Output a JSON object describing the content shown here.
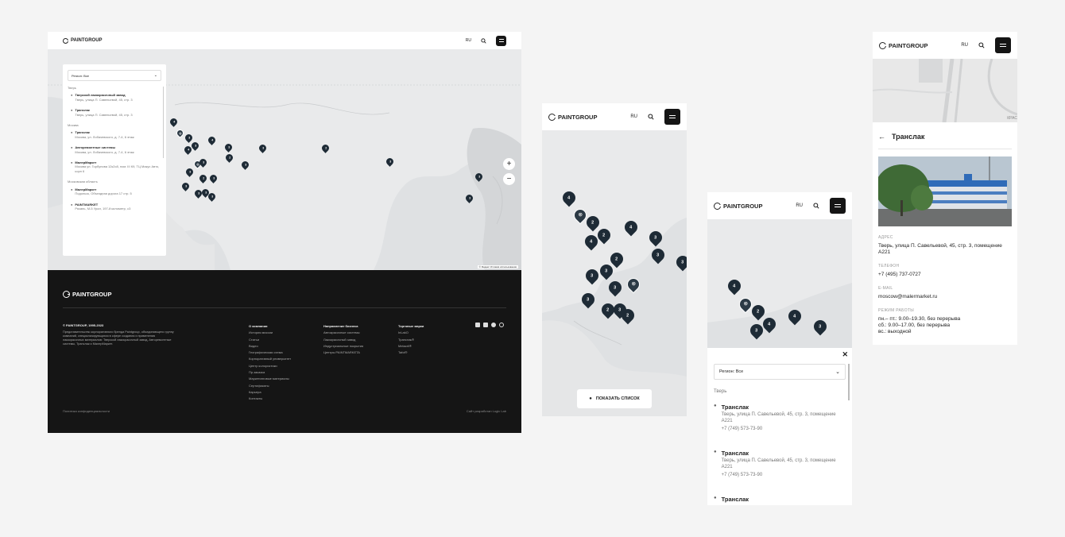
{
  "brand": "PAINTGROUP",
  "lang": "RU",
  "desktop": {
    "filter": "Регион: Все",
    "groups": [
      {
        "title": "Тверь",
        "items": [
          {
            "name": "Тверской лакокрасочный завод",
            "addr": "Тверь, улица П. Савельевой, 45, стр. 3"
          },
          {
            "name": "Транслак",
            "addr": "Тверь, улица П. Савельевой, 45, стр. 3"
          }
        ]
      },
      {
        "title": "Москва",
        "items": [
          {
            "name": "Транслак",
            "addr": "Москва, ул. Лобачевского, д. 7-4, 6 этаж"
          },
          {
            "name": "Авторемонтные системы",
            "addr": "Москва, ул. Лобачевского, д. 7-4, 6 этаж"
          },
          {
            "name": "МалерМаркет",
            "addr": "Москва ул. Горбунова 12к2с8, пом. III К9, ТЦ Макус Авто, корп 6"
          }
        ]
      },
      {
        "title": "Московская область",
        "items": [
          {
            "name": "МалерМаркет",
            "addr": "Подольск, Объездная дорога 17 стр. 5"
          },
          {
            "name": "PAINTMARKET",
            "addr": "Рязань, М-5 Урал, 197-й километр, с3"
          }
        ]
      }
    ],
    "map_attrib": "© Яндекс  Условия использования",
    "footer": {
      "copyright": "© PAINTGROUP, 1995-2023",
      "about": "Представительство корпоративного бренда Paintgroup, объединяющего группу компаний, специализирующихся в сфере создания и применения лакокрасочных материалов: Тверской лакокрасочный завод, Авторемонтные системы, Транслак и МалерМаркет.",
      "cols": [
        {
          "title": "О компании",
          "links": [
            "История миссии",
            "Статьи",
            "Видео",
            "Географическая схема",
            "Корпоративный университет",
            "Центр колористики",
            "Пр.заказка",
            "Маркетинговые материалы",
            "Сертификаты",
            "Карьера",
            "Контакты"
          ]
        },
        {
          "title": "Направление бизнеса",
          "links": [
            "Автокрасочные системы",
            "Лакокрасочный завод",
            "Индустриальные покрытия",
            "Центры PAINTMARKETA"
          ]
        },
        {
          "title": "Торговые марки",
          "links": [
            "InLakO",
            "Транслак®",
            "Metacril®",
            "Tafol®"
          ]
        }
      ],
      "privacy": "Политика конфиденциальности",
      "dev": "Сайт разработан Logic Lab"
    }
  },
  "mobile1": {
    "show_list": "ПОКАЗАТЬ СПИСОК"
  },
  "mobile2": {
    "filter": "Регион: Все",
    "group": "Тверь",
    "items": [
      {
        "name": "Транслак",
        "addr": "Тверь, улица П. Савельевой, 45, стр. 3, помещение А221",
        "phone": "+7 (749) 573-73-90"
      },
      {
        "name": "Транслак",
        "addr": "Тверь, улица П. Савельевой, 45, стр. 3, помещение А221",
        "phone": "+7 (749) 573-73-90"
      },
      {
        "name": "Транслак",
        "addr": "",
        "phone": ""
      }
    ]
  },
  "mobile3": {
    "title": "Транслак",
    "map_label": "КРАС",
    "address_label": "АДРЕС",
    "address": "Тверь, улица П. Савельевой, 45, стр. 3, помещение А221",
    "phone_label": "ТЕЛЕФОН",
    "phone": "+7 (495) 737-0727",
    "email_label": "E-MAIL",
    "email": "moscow@malermarket.ru",
    "hours_label": "РЕЖИМ РАБОТЫ",
    "hours": [
      "пн.– пт.: 9.00–19.30, без перерыва",
      "сб.: 9.00–17.00, без перерыва",
      "вс.: выходной"
    ]
  },
  "pins_desktop": [
    "4",
    "",
    "3",
    "3",
    "4",
    "4",
    "3",
    "3",
    "2",
    "3",
    "2",
    "3",
    "",
    "3",
    "3",
    "2",
    "3",
    "3",
    "3",
    "3",
    "3",
    "3",
    "3"
  ],
  "pins_m1": [
    "4",
    "",
    "2",
    "2",
    "4",
    "4",
    "3",
    "3",
    "3",
    "2",
    "3",
    "3",
    "",
    "3",
    "3",
    "2",
    "3",
    "2"
  ],
  "pins_m2": [
    "4",
    "",
    "2",
    "4",
    "4",
    "3",
    "3"
  ],
  "colors": {
    "pin": "#1e2b36",
    "footer": "#151515",
    "map": "#dfe1e3"
  }
}
